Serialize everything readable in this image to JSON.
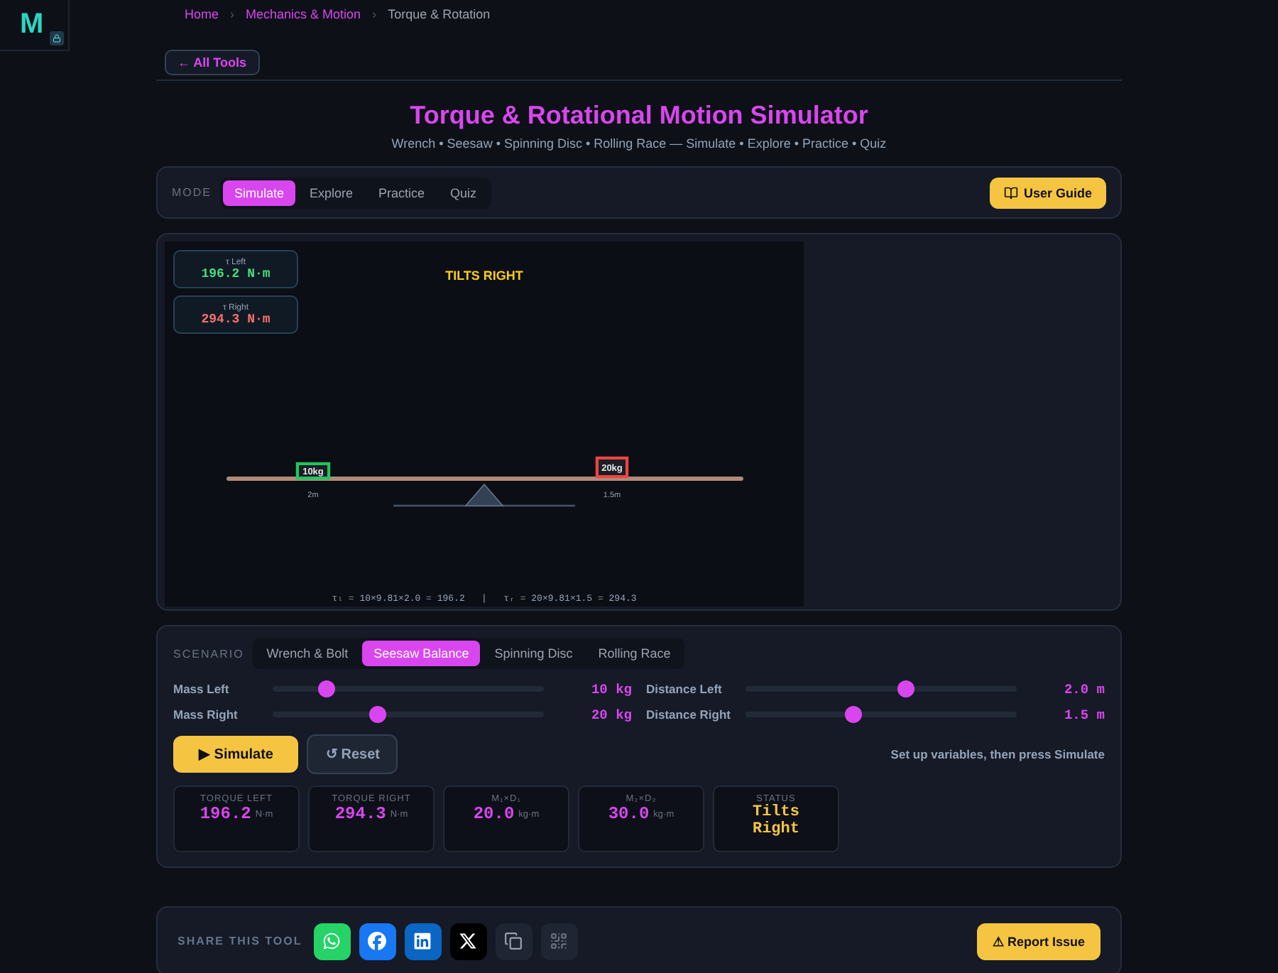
{
  "logo": {
    "letter": "M"
  },
  "breadcrumb": {
    "separator": "›",
    "items": [
      {
        "label": "Home",
        "kind": "link"
      },
      {
        "label": "Mechanics & Motion",
        "kind": "link"
      },
      {
        "label": "Torque & Rotation",
        "kind": "current"
      }
    ]
  },
  "back_button": "← All Tools",
  "title": "Torque & Rotational Motion Simulator",
  "subtitle": "Wrench • Seesaw • Spinning Disc • Rolling Race — Simulate • Explore • Practice • Quiz",
  "mode": {
    "label": "MODE",
    "tabs": [
      {
        "label": "Simulate",
        "selected": true
      },
      {
        "label": "Explore",
        "selected": false
      },
      {
        "label": "Practice",
        "selected": false
      },
      {
        "label": "Quiz",
        "selected": false
      }
    ]
  },
  "guide_button": "User Guide",
  "simulation": {
    "readouts": [
      {
        "label": "τ Left",
        "value": "196.2 N·m",
        "color": "#4ade80"
      },
      {
        "label": "τ Right",
        "value": "294.3 N·m",
        "color": "#f87171"
      }
    ],
    "verdict": "TILTS RIGHT",
    "masses": [
      {
        "label": "10kg",
        "distance": "2m",
        "color": "#22c55e"
      },
      {
        "label": "20kg",
        "distance": "1.5m",
        "color": "#ef4444"
      }
    ],
    "formula": "τₗ = 10×9.81×2.0 = 196.2   |   τᵣ = 20×9.81×1.5 = 294.3"
  },
  "scenario": {
    "label": "SCENARIO",
    "tabs": [
      {
        "label": "Wrench & Bolt",
        "selected": false
      },
      {
        "label": "Seesaw Balance",
        "selected": true
      },
      {
        "label": "Spinning Disc",
        "selected": false
      },
      {
        "label": "Rolling Race",
        "selected": false
      }
    ]
  },
  "sliders": [
    {
      "label": "Mass Left",
      "level": 0.2,
      "reading": "10 kg"
    },
    {
      "label": "Distance Left",
      "level": 0.59,
      "reading": "2.0 m"
    },
    {
      "label": "Mass Right",
      "level": 0.39,
      "reading": "20 kg"
    },
    {
      "label": "Distance Right",
      "level": 0.4,
      "reading": "1.5 m"
    }
  ],
  "actions": {
    "simulate": "▶ Simulate",
    "reset": "↺ Reset",
    "hint": "Set up variables, then press Simulate"
  },
  "stats": [
    {
      "kind": "number",
      "label": "TORQUE LEFT",
      "value": "196.2",
      "unit": "N·m"
    },
    {
      "kind": "number",
      "label": "TORQUE RIGHT",
      "value": "294.3",
      "unit": "N·m"
    },
    {
      "kind": "number",
      "label": "M₁×D₁",
      "value": "20.0",
      "unit": "kg·m"
    },
    {
      "kind": "number",
      "label": "M₂×D₂",
      "value": "30.0",
      "unit": "kg·m"
    },
    {
      "kind": "status",
      "label": "STATUS",
      "value": "Tilts Right"
    }
  ],
  "share": {
    "label": "SHARE THIS TOOL",
    "buttons": [
      {
        "kind": "whatsapp"
      },
      {
        "kind": "facebook"
      },
      {
        "kind": "linkedin"
      },
      {
        "kind": "x"
      },
      {
        "kind": "copy"
      },
      {
        "kind": "qr"
      }
    ]
  },
  "report_button": "⚠ Report Issue"
}
